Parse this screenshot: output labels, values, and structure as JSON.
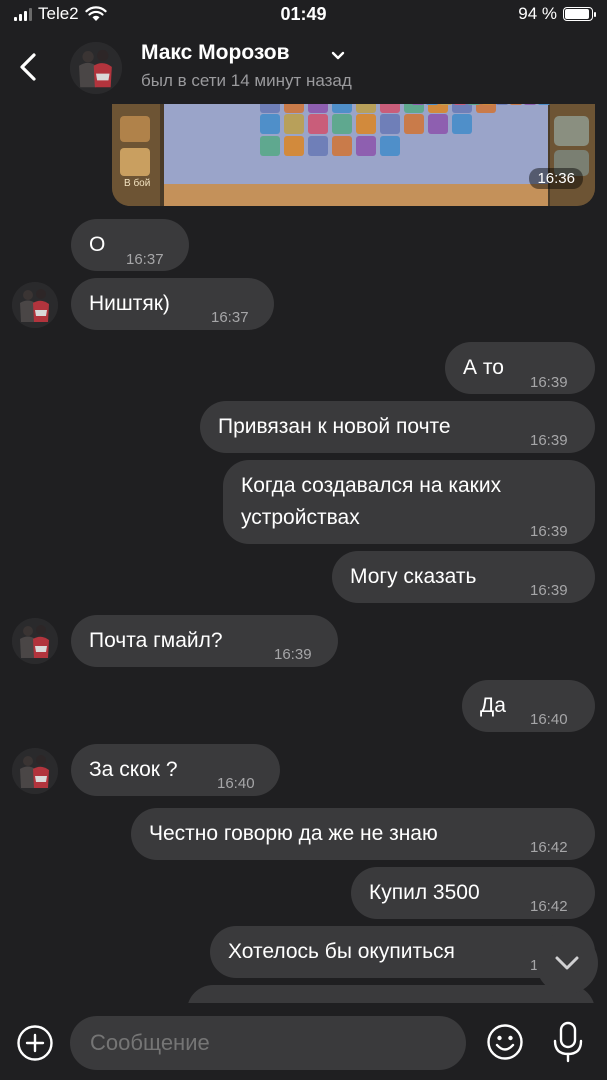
{
  "status_bar": {
    "carrier": "Tele2",
    "time": "01:49",
    "battery": "94 %",
    "battery_level": 0.94
  },
  "header": {
    "contact_name": "Макс Морозов",
    "contact_status": "был в сети 14 минут назад"
  },
  "media": {
    "time": "16:36",
    "tile_label": "В бой"
  },
  "messages": [
    {
      "text": "О",
      "time": "16:37"
    },
    {
      "text": "Ништяк)",
      "time": "16:37"
    },
    {
      "text": "А то",
      "time": "16:39"
    },
    {
      "text": "Привязан к новой почте",
      "time": "16:39"
    },
    {
      "text": "Когда создавался на каких устройствах",
      "time": "16:39"
    },
    {
      "text": "Могу сказать",
      "time": "16:39"
    },
    {
      "text": "Почта гмайл?",
      "time": "16:39"
    },
    {
      "text": "Да",
      "time": "16:40"
    },
    {
      "text": "За скок ?",
      "time": "16:40"
    },
    {
      "text": "Честно говорю да же не знаю",
      "time": "16:42"
    },
    {
      "text": "Купил 3500",
      "time": "16:42"
    },
    {
      "text": "Хотелось бы окупиться",
      "time": "16:42"
    }
  ],
  "composer": {
    "placeholder": "Сообщение"
  },
  "icons": {
    "back": "chevron-left-icon",
    "contact_menu": "chevron-down-icon",
    "plus": "plus-circle-icon",
    "emoji": "emoji-icon",
    "mic": "microphone-icon",
    "scroll_down": "chevron-down-icon"
  },
  "colors": {
    "background": "#1f1f21",
    "bubble": "#3a3a3c",
    "secondary_text": "#9a9a9d"
  }
}
